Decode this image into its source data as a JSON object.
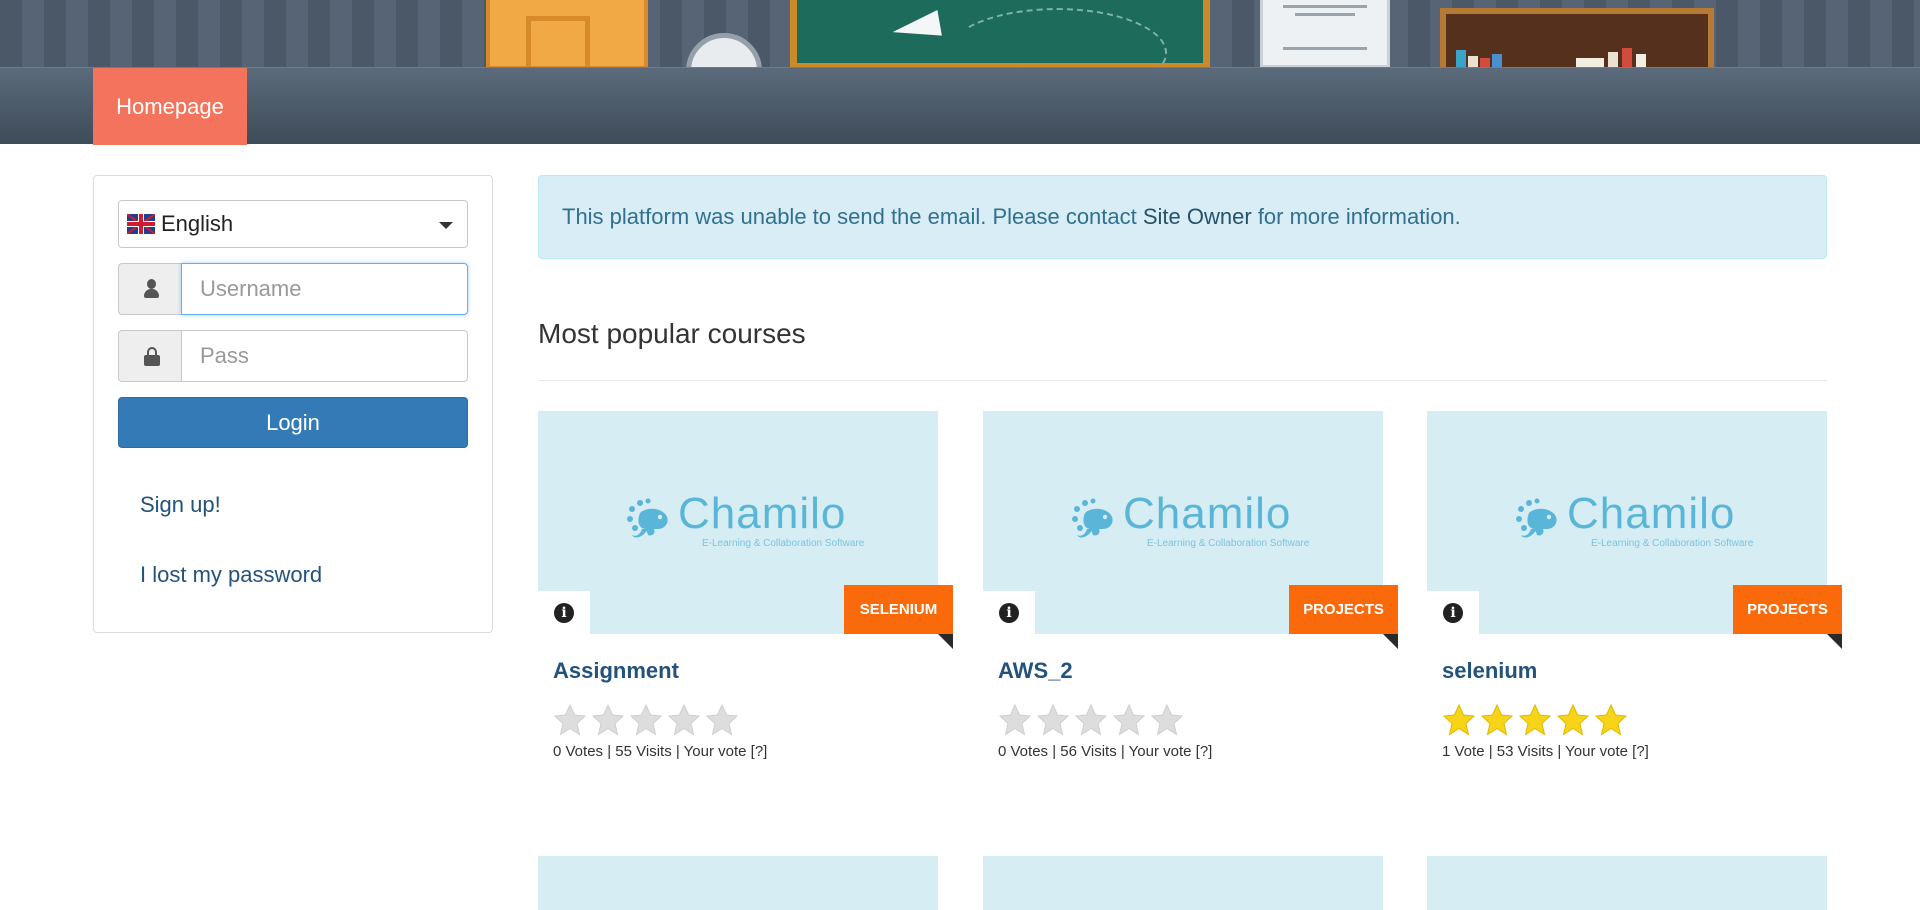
{
  "nav": {
    "home_label": "Homepage",
    "active_color": "#f4735c"
  },
  "login": {
    "language": {
      "selected": "English",
      "flag_icon": "uk-flag-icon"
    },
    "username": {
      "placeholder": "Username",
      "value": "",
      "icon": "user-icon"
    },
    "password": {
      "placeholder": "Pass",
      "value": "",
      "icon": "lock-icon"
    },
    "login_button": "Login",
    "signup_link": "Sign up!",
    "lost_password_link": "I lost my password"
  },
  "alert": {
    "text_before": "This platform was unable to send the email. Please contact ",
    "link": "Site Owner",
    "text_after": " for more information."
  },
  "section": {
    "title": "Most popular courses"
  },
  "courses": [
    {
      "title": "Assignment",
      "category": "SELENIUM",
      "rating": 0,
      "votes": "0 Votes",
      "visits": "55 Visits",
      "your_vote": "Your vote [?]",
      "image_logo": "Chamilo",
      "image_tagline": "E-Learning & Collaboration Software"
    },
    {
      "title": "AWS_2",
      "category": "PROJECTS",
      "rating": 0,
      "votes": "0 Votes",
      "visits": "56 Visits",
      "your_vote": "Your vote [?]",
      "image_logo": "Chamilo",
      "image_tagline": "E-Learning & Collaboration Software"
    },
    {
      "title": "selenium",
      "category": "PROJECTS",
      "rating": 5,
      "votes": "1 Vote",
      "visits": "53 Visits",
      "your_vote": "Your vote [?]",
      "image_logo": "Chamilo",
      "image_tagline": "E-Learning & Collaboration Software"
    }
  ],
  "colors": {
    "primary_button": "#337ab7",
    "link": "#23527c",
    "category_tag": "#fa6a0a",
    "alert_bg": "#d9edf7",
    "star_filled": "#f7d417",
    "star_empty": "#dddddd"
  }
}
